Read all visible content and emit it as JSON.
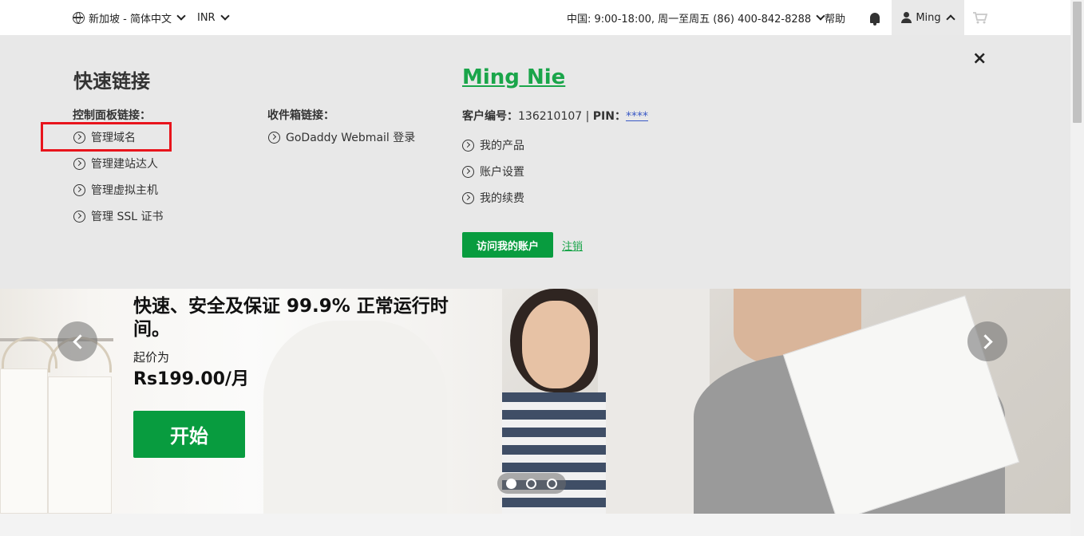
{
  "topbar": {
    "region": "新加坡 - 简体中文",
    "currency": "INR",
    "support": "中国: 9:00-18:00, 周一至周五  (86) 400-842-8288",
    "help": "帮助",
    "user": "Ming"
  },
  "quick_links": {
    "title": "快速链接",
    "close": "×",
    "dashboard": {
      "heading": "控制面板链接：",
      "links": [
        "管理域名",
        "管理建站达人",
        "管理虚拟主机",
        "管理 SSL 证书"
      ]
    },
    "inbox": {
      "heading": "收件箱链接：",
      "links": [
        "GoDaddy Webmail 登录"
      ]
    },
    "account": {
      "name": "Ming Nie",
      "customer_label": "客户编号：",
      "customer_number": "136210107",
      "separator": " | ",
      "pin_label": "PIN：",
      "pin_value": "****",
      "links": [
        "我的产品",
        "账户设置",
        "我的续费"
      ],
      "visit_button": "访问我的账户",
      "logout": "注销"
    }
  },
  "hero": {
    "headline": "快速、安全及保证 99.9% 正常运行时间。",
    "from": "起价为",
    "price": "Rs199.00/月",
    "cta": "开始",
    "slides_total": 3,
    "slide_active": 1
  },
  "colors": {
    "brand_green": "#089c3f",
    "link_green": "#1aa54a",
    "highlight_red": "#e8141c",
    "panel_bg": "#e8e8e8"
  }
}
